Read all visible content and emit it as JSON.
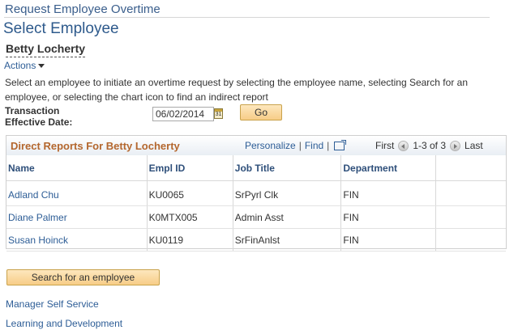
{
  "page": {
    "header": "Request Employee Overtime",
    "title": "Select Employee",
    "employee_name": "Betty Locherty",
    "actions_label": "Actions",
    "instructions": "Select an employee to initiate an overtime request by selecting the employee name, selecting Search for an employee, or selecting the chart icon to find an indirect report"
  },
  "form": {
    "date_label": "Transaction Effective Date:",
    "date_value": "06/02/2014",
    "go_label": "Go"
  },
  "grid": {
    "title": "Direct Reports For Betty Locherty",
    "personalize": "Personalize",
    "find": "Find",
    "first": "First",
    "range": "1-3 of 3",
    "last": "Last",
    "columns": [
      "Name",
      "Empl ID",
      "Job Title",
      "Department"
    ],
    "rows": [
      {
        "name": "Adland Chu",
        "emplid": "KU0065",
        "job": "SrPyrl Clk",
        "dept": "FIN"
      },
      {
        "name": "Diane Palmer",
        "emplid": "K0MTX005",
        "job": "Admin Asst",
        "dept": "FIN"
      },
      {
        "name": "Susan Hoinck",
        "emplid": "KU0119",
        "job": "SrFinAnlst",
        "dept": "FIN"
      }
    ]
  },
  "footer": {
    "search_button": "Search for an employee",
    "links": [
      "Manager Self Service",
      "Learning and Development"
    ]
  },
  "colors": {
    "title_blue": "#2e5a8c",
    "link_blue": "#2d5d96",
    "grid_title_orange": "#b4672e",
    "button_fill": "#f7cd87"
  },
  "icons": [
    "caret-down-icon",
    "calendar-icon",
    "new-window-icon",
    "previous-icon",
    "next-icon"
  ]
}
